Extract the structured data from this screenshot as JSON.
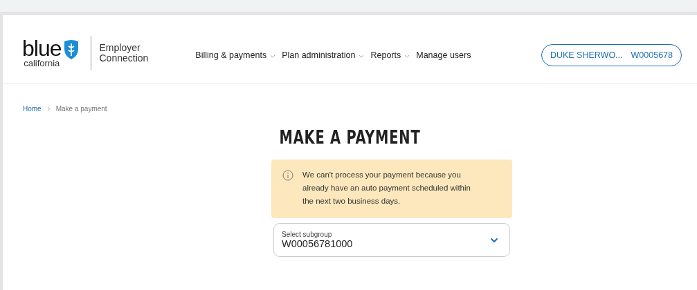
{
  "header": {
    "logo": {
      "wordmark": "blue",
      "sub": "california"
    },
    "product": [
      "Employer",
      "Connection"
    ],
    "nav": [
      {
        "label": "Billing & payments",
        "dropdown": true
      },
      {
        "label": "Plan administration",
        "dropdown": true
      },
      {
        "label": "Reports",
        "dropdown": true
      },
      {
        "label": "Manage users",
        "dropdown": false
      }
    ],
    "account": {
      "name": "DUKE SHERWO...",
      "id": "W0005678"
    }
  },
  "breadcrumb": [
    "Home",
    "Make a payment"
  ],
  "title": "MAKE A PAYMENT",
  "alert": {
    "message": "We can't process your payment because you already have an auto payment scheduled within the next two business days."
  },
  "subgroup_select": {
    "label": "Select subgroup",
    "value": "W00056781000"
  }
}
